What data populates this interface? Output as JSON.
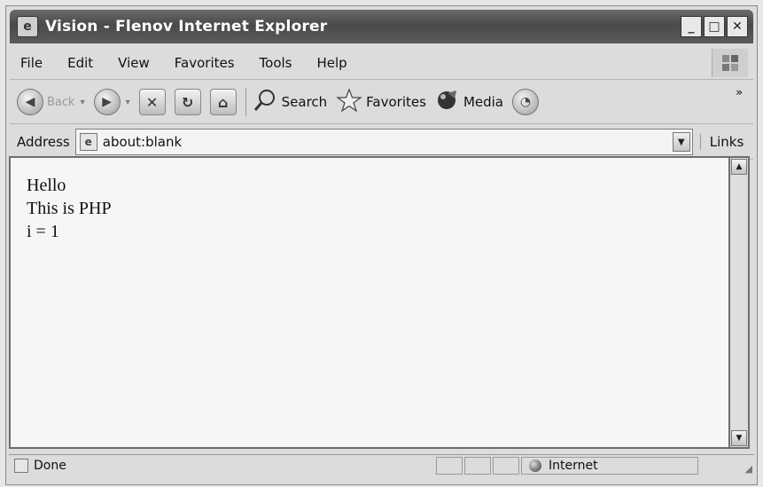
{
  "window": {
    "title": "Vision - Flenov Internet Explorer",
    "buttons": {
      "minimize": "_",
      "maximize": "□",
      "close": "✕"
    }
  },
  "menu": {
    "items": [
      "File",
      "Edit",
      "View",
      "Favorites",
      "Tools",
      "Help"
    ]
  },
  "toolbar": {
    "back_label": "Back",
    "search_label": "Search",
    "favorites_label": "Favorites",
    "media_label": "Media",
    "more": "»"
  },
  "address": {
    "label": "Address",
    "value": "about:blank",
    "links_label": "Links"
  },
  "content": {
    "lines": [
      "Hello",
      "This is PHP",
      "i = 1"
    ]
  },
  "status": {
    "text": "Done",
    "zone": "Internet"
  }
}
